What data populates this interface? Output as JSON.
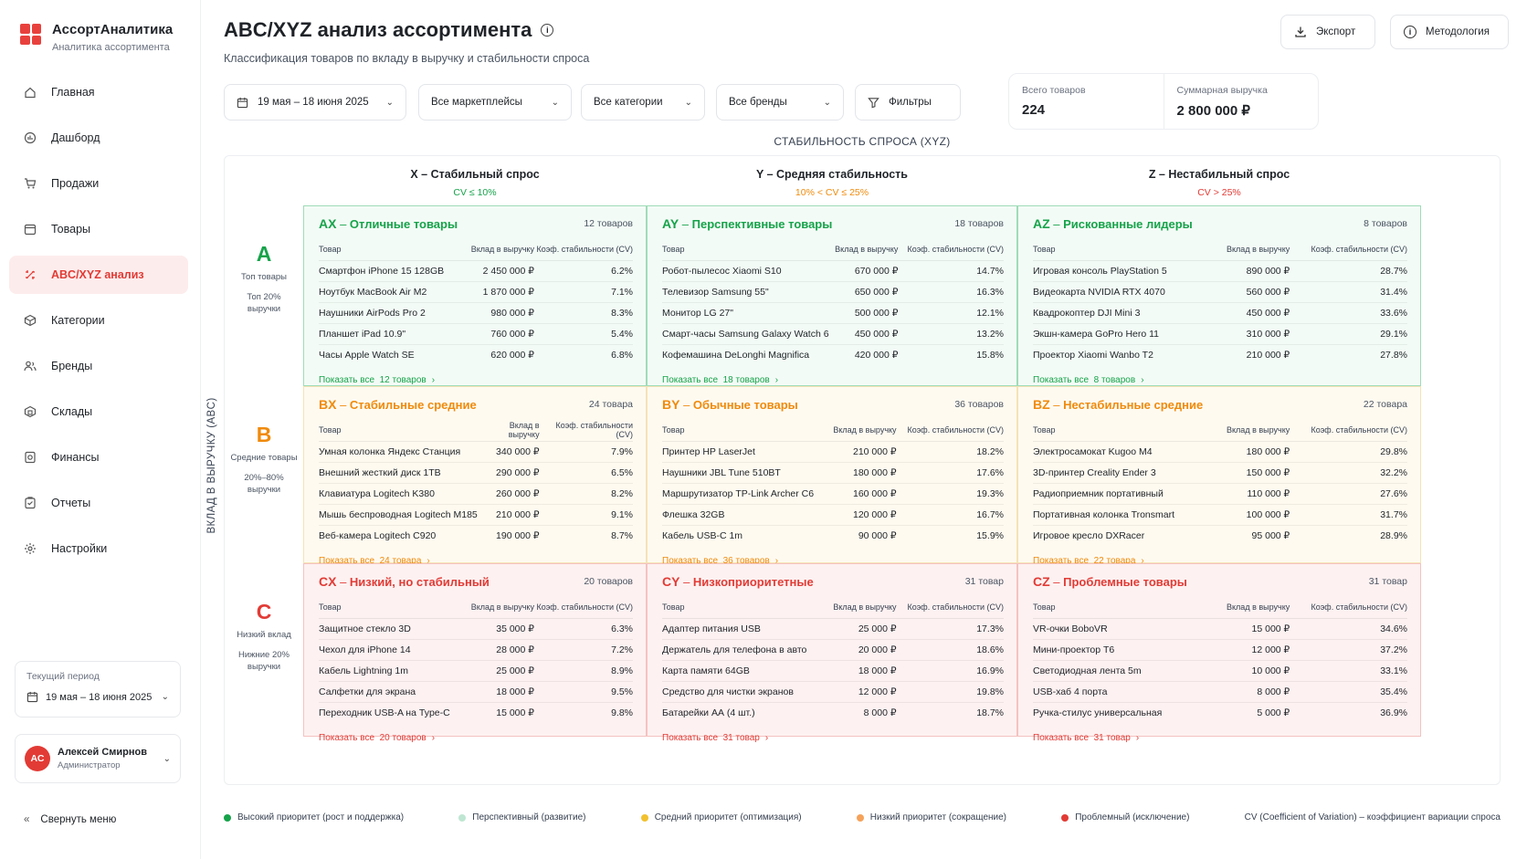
{
  "app": {
    "title": "АссортАналитика",
    "subtitle": "Аналитика ассортимента"
  },
  "nav": [
    {
      "label": "Главная",
      "icon": "home-icon"
    },
    {
      "label": "Дашборд",
      "icon": "dashboard-icon"
    },
    {
      "label": "Продажи",
      "icon": "cart-icon"
    },
    {
      "label": "Товары",
      "icon": "box-icon"
    },
    {
      "label": "ABC/XYZ анализ",
      "icon": "matrix-icon",
      "active": true
    },
    {
      "label": "Категории",
      "icon": "category-icon"
    },
    {
      "label": "Бренды",
      "icon": "users-icon"
    },
    {
      "label": "Склады",
      "icon": "warehouse-icon"
    },
    {
      "label": "Финансы",
      "icon": "finance-icon"
    },
    {
      "label": "Отчеты",
      "icon": "report-icon"
    },
    {
      "label": "Настройки",
      "icon": "gear-icon"
    }
  ],
  "period": {
    "label": "Текущий период",
    "value": "19 мая – 18 июня 2025"
  },
  "user": {
    "initials": "АС",
    "name": "Алексей Смирнов",
    "role": "Администратор"
  },
  "collapse_label": "Свернуть меню",
  "header": {
    "title": "ABC/XYZ анализ ассортимента",
    "subtitle": "Классификация товаров по вкладу в выручку и стабильности спроса",
    "export_label": "Экспорт",
    "method_label": "Методология"
  },
  "filters": {
    "date": "19 мая – 18 июня 2025",
    "marketplaces": "Все маркетплейсы",
    "categories": "Все категории",
    "brands": "Все бренды",
    "more": "Фильтры"
  },
  "stats": {
    "total_label": "Всего товаров",
    "total_value": "224",
    "revenue_label": "Суммарная выручка",
    "revenue_value": "2 800 000 ₽"
  },
  "xyz_title": "СТАБИЛЬНОСТЬ СПРОСА (XYZ)",
  "abc_title": "ВКЛАД В ВЫРУЧКУ (ABC)",
  "columns": [
    {
      "title": "X – Стабильный спрос",
      "cv": "CV ≤ 10%"
    },
    {
      "title": "Y – Средняя стабильность",
      "cv": "10% < CV ≤ 25%"
    },
    {
      "title": "Z – Нестабильный спрос",
      "cv": "CV > 25%"
    }
  ],
  "rows": [
    {
      "letter": "A",
      "name": "Топ товары",
      "share": "Топ 20% выручки"
    },
    {
      "letter": "B",
      "name": "Средние товары",
      "share": "20%–80% выручки"
    },
    {
      "letter": "C",
      "name": "Низкий вклад",
      "share": "Нижние 20% выручки"
    }
  ],
  "table_headers": {
    "product": "Товар",
    "revenue": "Вклад в выручку",
    "cv": "Коэф. стабильности (CV)"
  },
  "cells": {
    "AX": {
      "code": "AX",
      "title": "Отличные товары",
      "count": "12 товаров",
      "show_all": "Показать все  12 товаров",
      "items": [
        [
          "Смартфон iPhone 15 128GB",
          "2 450 000 ₽",
          "6.2%"
        ],
        [
          "Ноутбук MacBook Air M2",
          "1 870 000 ₽",
          "7.1%"
        ],
        [
          "Наушники AirPods Pro 2",
          "980 000 ₽",
          "8.3%"
        ],
        [
          "Планшет iPad 10.9\"",
          "760 000 ₽",
          "5.4%"
        ],
        [
          "Часы Apple Watch SE",
          "620 000 ₽",
          "6.8%"
        ]
      ]
    },
    "AY": {
      "code": "AY",
      "title": "Перспективные товары",
      "count": "18 товаров",
      "show_all": "Показать все  18 товаров",
      "items": [
        [
          "Робот-пылесос Xiaomi S10",
          "670 000 ₽",
          "14.7%"
        ],
        [
          "Телевизор Samsung 55\"",
          "650 000 ₽",
          "16.3%"
        ],
        [
          "Монитор LG 27\"",
          "500 000 ₽",
          "12.1%"
        ],
        [
          "Смарт-часы Samsung Galaxy Watch 6",
          "450 000 ₽",
          "13.2%"
        ],
        [
          "Кофемашина DeLonghi Magnifica",
          "420 000 ₽",
          "15.8%"
        ]
      ]
    },
    "AZ": {
      "code": "AZ",
      "title": "Рискованные лидеры",
      "count": "8 товаров",
      "show_all": "Показать все  8 товаров",
      "items": [
        [
          "Игровая консоль PlayStation 5",
          "890 000 ₽",
          "28.7%"
        ],
        [
          "Видеокарта NVIDIA RTX 4070",
          "560 000 ₽",
          "31.4%"
        ],
        [
          "Квадрокоптер DJI Mini 3",
          "450 000 ₽",
          "33.6%"
        ],
        [
          "Экшн-камера GoPro Hero 11",
          "310 000 ₽",
          "29.1%"
        ],
        [
          "Проектор Xiaomi Wanbo T2",
          "210 000 ₽",
          "27.8%"
        ]
      ]
    },
    "BX": {
      "code": "BX",
      "title": "Стабильные средние",
      "count": "24 товара",
      "show_all": "Показать все  24 товара",
      "items": [
        [
          "Умная колонка Яндекс Станция",
          "340 000 ₽",
          "7.9%"
        ],
        [
          "Внешний жесткий диск 1TB",
          "290 000 ₽",
          "6.5%"
        ],
        [
          "Клавиатура Logitech K380",
          "260 000 ₽",
          "8.2%"
        ],
        [
          "Мышь беспроводная Logitech M185",
          "210 000 ₽",
          "9.1%"
        ],
        [
          "Веб-камера Logitech C920",
          "190 000 ₽",
          "8.7%"
        ]
      ]
    },
    "BY": {
      "code": "BY",
      "title": "Обычные товары",
      "count": "36 товаров",
      "show_all": "Показать все  36 товаров",
      "items": [
        [
          "Принтер HP LaserJet",
          "210 000 ₽",
          "18.2%"
        ],
        [
          "Наушники JBL Tune 510BT",
          "180 000 ₽",
          "17.6%"
        ],
        [
          "Маршрутизатор TP-Link Archer C6",
          "160 000 ₽",
          "19.3%"
        ],
        [
          "Флешка 32GB",
          "120 000 ₽",
          "16.7%"
        ],
        [
          "Кабель USB-C 1m",
          "90 000 ₽",
          "15.9%"
        ]
      ]
    },
    "BZ": {
      "code": "BZ",
      "title": "Нестабильные средние",
      "count": "22 товара",
      "show_all": "Показать все  22 товара",
      "items": [
        [
          "Электросамокат Kugoo M4",
          "180 000 ₽",
          "29.8%"
        ],
        [
          "3D-принтер Creality Ender 3",
          "150 000 ₽",
          "32.2%"
        ],
        [
          "Радиоприемник портативный",
          "110 000 ₽",
          "27.6%"
        ],
        [
          "Портативная колонка Tronsmart",
          "100 000 ₽",
          "31.7%"
        ],
        [
          "Игровое кресло DXRacer",
          "95 000 ₽",
          "28.9%"
        ]
      ]
    },
    "CX": {
      "code": "CX",
      "title": "Низкий, но стабильный",
      "count": "20 товаров",
      "show_all": "Показать все  20 товаров",
      "items": [
        [
          "Защитное стекло 3D",
          "35 000 ₽",
          "6.3%"
        ],
        [
          "Чехол для iPhone 14",
          "28 000 ₽",
          "7.2%"
        ],
        [
          "Кабель Lightning 1m",
          "25 000 ₽",
          "8.9%"
        ],
        [
          "Салфетки для экрана",
          "18 000 ₽",
          "9.5%"
        ],
        [
          "Переходник USB-A на Type-C",
          "15 000 ₽",
          "9.8%"
        ]
      ]
    },
    "CY": {
      "code": "CY",
      "title": "Низкоприоритетные",
      "count": "31 товар",
      "show_all": "Показать все  31 товар",
      "items": [
        [
          "Адаптер питания USB",
          "25 000 ₽",
          "17.3%"
        ],
        [
          "Держатель для телефона в авто",
          "20 000 ₽",
          "18.6%"
        ],
        [
          "Карта памяти 64GB",
          "18 000 ₽",
          "16.9%"
        ],
        [
          "Средство для чистки экранов",
          "12 000 ₽",
          "19.8%"
        ],
        [
          "Батарейки АА (4 шт.)",
          "8 000 ₽",
          "18.7%"
        ]
      ]
    },
    "CZ": {
      "code": "CZ",
      "title": "Проблемные товары",
      "count": "31 товар",
      "show_all": "Показать все  31 товар",
      "items": [
        [
          "VR-очки BoboVR",
          "15 000 ₽",
          "34.6%"
        ],
        [
          "Мини-проектор T6",
          "12 000 ₽",
          "37.2%"
        ],
        [
          "Светодиодная лента 5m",
          "10 000 ₽",
          "33.1%"
        ],
        [
          "USB-хаб 4 порта",
          "8 000 ₽",
          "35.4%"
        ],
        [
          "Ручка-стилус универсальная",
          "5 000 ₽",
          "36.9%"
        ]
      ]
    }
  },
  "legend": [
    {
      "label": "Высокий приоритет (рост и поддержка)",
      "color": "#16a34a"
    },
    {
      "label": "Перспективный (развитие)",
      "color": "#bfe6d2"
    },
    {
      "label": "Средний приоритет (оптимизация)",
      "color": "#f2c12e"
    },
    {
      "label": "Низкий приоритет (сокращение)",
      "color": "#f5a25a"
    },
    {
      "label": "Проблемный (исключение)",
      "color": "#e23b35"
    }
  ],
  "legend_note": "CV (Coefficient of Variation) – коэффициент вариации спроса"
}
